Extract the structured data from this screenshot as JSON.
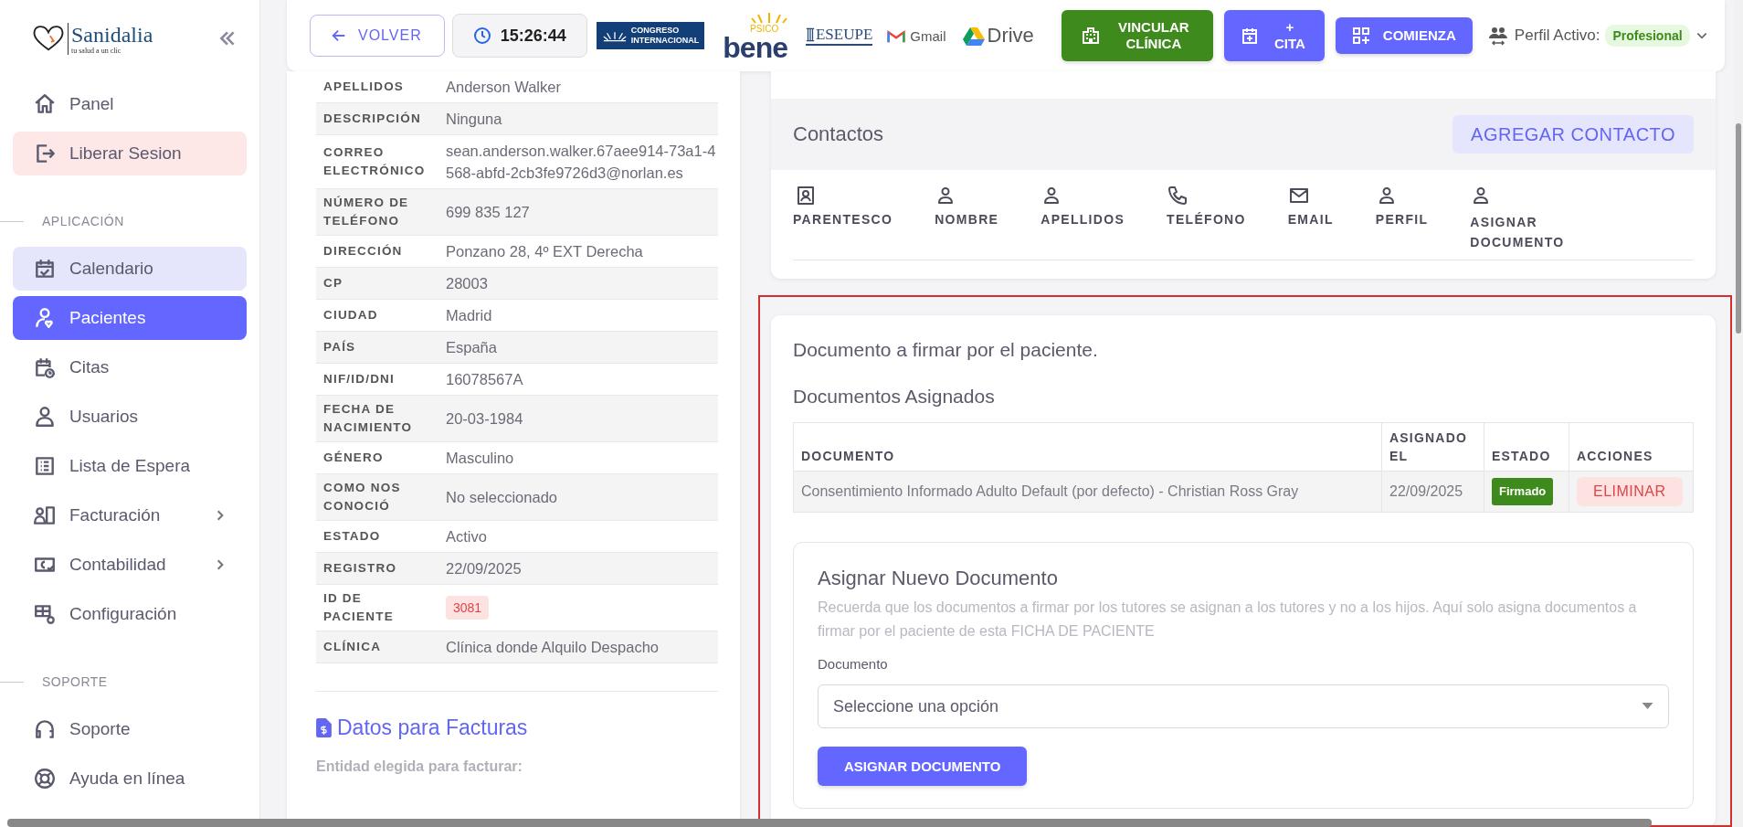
{
  "sidebar": {
    "logo": {
      "name": "Sanidalia",
      "tagline": "tu salud a un clic"
    },
    "items": [
      {
        "kind": "link",
        "label": "Panel",
        "selected": false,
        "highlighted": false,
        "expandable": false
      },
      {
        "kind": "danger",
        "label": "Liberar Sesion",
        "selected": false,
        "highlighted": false,
        "expandable": false
      },
      {
        "kind": "section",
        "label": "APLICACIÓN"
      },
      {
        "kind": "link",
        "label": "Calendario",
        "selected": false,
        "highlighted": true,
        "expandable": false
      },
      {
        "kind": "link",
        "label": "Pacientes",
        "selected": true,
        "highlighted": false,
        "expandable": false
      },
      {
        "kind": "link",
        "label": "Citas",
        "selected": false,
        "highlighted": false,
        "expandable": false
      },
      {
        "kind": "link",
        "label": "Usuarios",
        "selected": false,
        "highlighted": false,
        "expandable": false
      },
      {
        "kind": "link",
        "label": "Lista de Espera",
        "selected": false,
        "highlighted": false,
        "expandable": false
      },
      {
        "kind": "link",
        "label": "Facturación",
        "selected": false,
        "highlighted": false,
        "expandable": true
      },
      {
        "kind": "link",
        "label": "Contabilidad",
        "selected": false,
        "highlighted": false,
        "expandable": true
      },
      {
        "kind": "link",
        "label": "Configuración",
        "selected": false,
        "highlighted": false,
        "expandable": false
      },
      {
        "kind": "section",
        "label": "SOPORTE"
      },
      {
        "kind": "link",
        "label": "Soporte",
        "selected": false,
        "highlighted": false,
        "expandable": false
      },
      {
        "kind": "link",
        "label": "Ayuda en línea",
        "selected": false,
        "highlighted": false,
        "expandable": false
      }
    ]
  },
  "header": {
    "back_button": "VOLVER",
    "clock": "15:26:44",
    "logos": [
      {
        "kind": "congreso",
        "lines": [
          "CONGRESO",
          "INTERNACIONAL"
        ]
      },
      {
        "kind": "psicobene",
        "small": "PSICO",
        "text": "bene"
      },
      {
        "kind": "eseupe",
        "text": "ESEUPE"
      },
      {
        "kind": "gmail",
        "text": "Gmail"
      },
      {
        "kind": "drive",
        "text": "Drive"
      }
    ],
    "buttons": [
      {
        "kind": "clinic",
        "label": "VINCULAR CLÍNICA"
      },
      {
        "kind": "cita",
        "label": "+ CITA"
      },
      {
        "kind": "start",
        "label": "COMIENZA"
      }
    ],
    "profile": {
      "label": "Perfil Activo:",
      "value": "Profesional"
    }
  },
  "patient": {
    "rows": [
      {
        "kind": "text",
        "label": "APELLIDOS",
        "value": "Anderson Walker"
      },
      {
        "kind": "text",
        "label": "DESCRIPCIÓN",
        "value": "Ninguna"
      },
      {
        "kind": "text",
        "label": "CORREO ELECTRÓNICO",
        "value": "sean.anderson.walker.67aee914-73a1-4568-abfd-2cb3fe9726d3@norlan.es"
      },
      {
        "kind": "text",
        "label": "NÚMERO DE TELÉFONO",
        "value": "699 835 127"
      },
      {
        "kind": "text",
        "label": "DIRECCIÓN",
        "value": "Ponzano 28, 4º EXT Derecha"
      },
      {
        "kind": "text",
        "label": "CP",
        "value": "28003"
      },
      {
        "kind": "text",
        "label": "CIUDAD",
        "value": "Madrid"
      },
      {
        "kind": "text",
        "label": "PAÍS",
        "value": "España"
      },
      {
        "kind": "text",
        "label": "NIF/ID/DNI",
        "value": "16078567A"
      },
      {
        "kind": "text",
        "label": "FECHA DE NACIMIENTO",
        "value": "20-03-1984"
      },
      {
        "kind": "text",
        "label": "GÉNERO",
        "value": "Masculino"
      },
      {
        "kind": "text",
        "label": "COMO NOS CONOCIÓ",
        "value": "No seleccionado"
      },
      {
        "kind": "text",
        "label": "ESTADO",
        "value": "Activo"
      },
      {
        "kind": "text",
        "label": "REGISTRO",
        "value": "22/09/2025"
      },
      {
        "kind": "badge",
        "label": "ID DE PACIENTE",
        "value": "3081"
      },
      {
        "kind": "text",
        "label": "CLÍNICA",
        "value": "Clínica donde Alquilo Despacho"
      }
    ],
    "billing_title": "Datos para Facturas",
    "billing_entity_label": "Entidad elegida para facturar:"
  },
  "contacts": {
    "title": "Contactos",
    "add_button": "AGREGAR CONTACTO",
    "columns": [
      {
        "kind": "card",
        "label": "PARENTESCO"
      },
      {
        "kind": "person",
        "label": "NOMBRE"
      },
      {
        "kind": "person",
        "label": "APELLIDOS"
      },
      {
        "kind": "phone",
        "label": "TELÉFONO"
      },
      {
        "kind": "mail",
        "label": "EMAIL"
      },
      {
        "kind": "person",
        "label": "PERFIL"
      },
      {
        "kind": "person",
        "label": "ASIGNAR DOCUMENTO"
      }
    ]
  },
  "documents": {
    "title": "Documento a firmar por el paciente.",
    "subtitle": "Documentos Asignados",
    "columns": [
      "DOCUMENTO",
      "ASIGNADO EL",
      "ESTADO",
      "ACCIONES"
    ],
    "rows": [
      {
        "document": "Consentimiento Informado Adulto Default (por defecto) - Christian Ross Gray",
        "assigned": "22/09/2025",
        "status": "Firmado",
        "action": "ELIMINAR"
      }
    ],
    "new": {
      "title": "Asignar Nuevo Documento",
      "help": "Recuerda que los documentos a firmar por los tutores se asignan a los tutores y no a los hijos. Aquí solo asigna documentos a firmar por el paciente de esta FICHA DE PACIENTE",
      "field_label": "Documento",
      "placeholder": "Seleccione una opción",
      "button": "ASIGNAR DOCUMENTO"
    }
  }
}
